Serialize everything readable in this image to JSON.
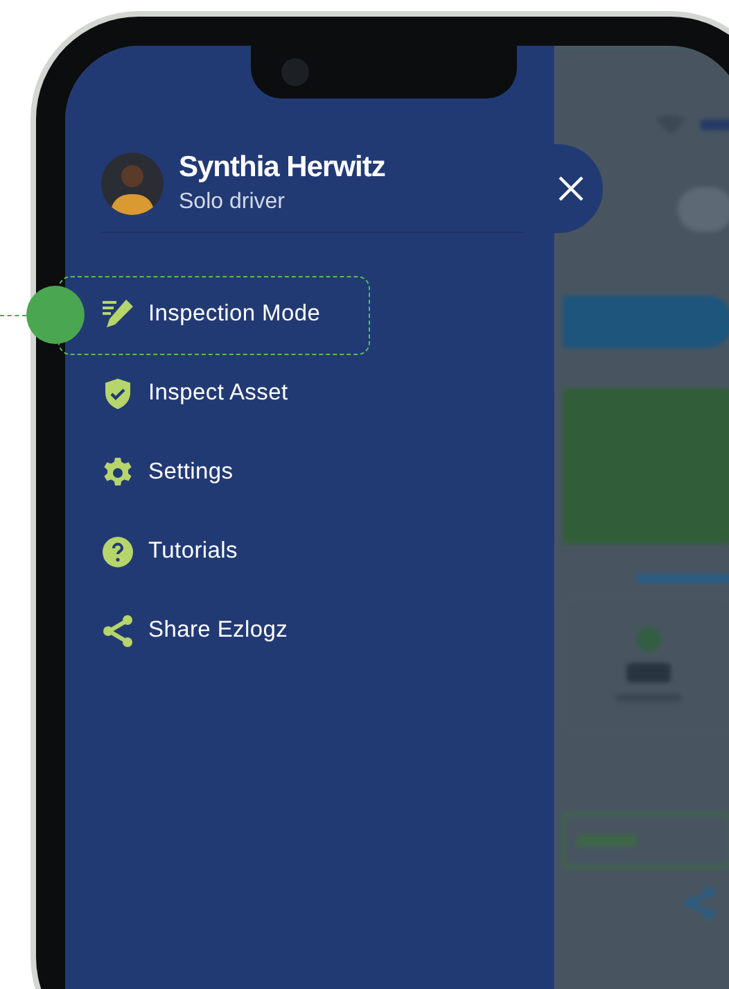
{
  "profile": {
    "name": "Synthia Herwitz",
    "role": "Solo driver"
  },
  "menu": [
    {
      "kind": "pencil",
      "label": "Inspection Mode",
      "highlighted": true
    },
    {
      "kind": "shield",
      "label": "Inspect Asset",
      "highlighted": false
    },
    {
      "kind": "gear",
      "label": "Settings",
      "highlighted": false
    },
    {
      "kind": "help",
      "label": "Tutorials",
      "highlighted": false
    },
    {
      "kind": "share",
      "label": "Share Ezlogz",
      "highlighted": false
    }
  ]
}
